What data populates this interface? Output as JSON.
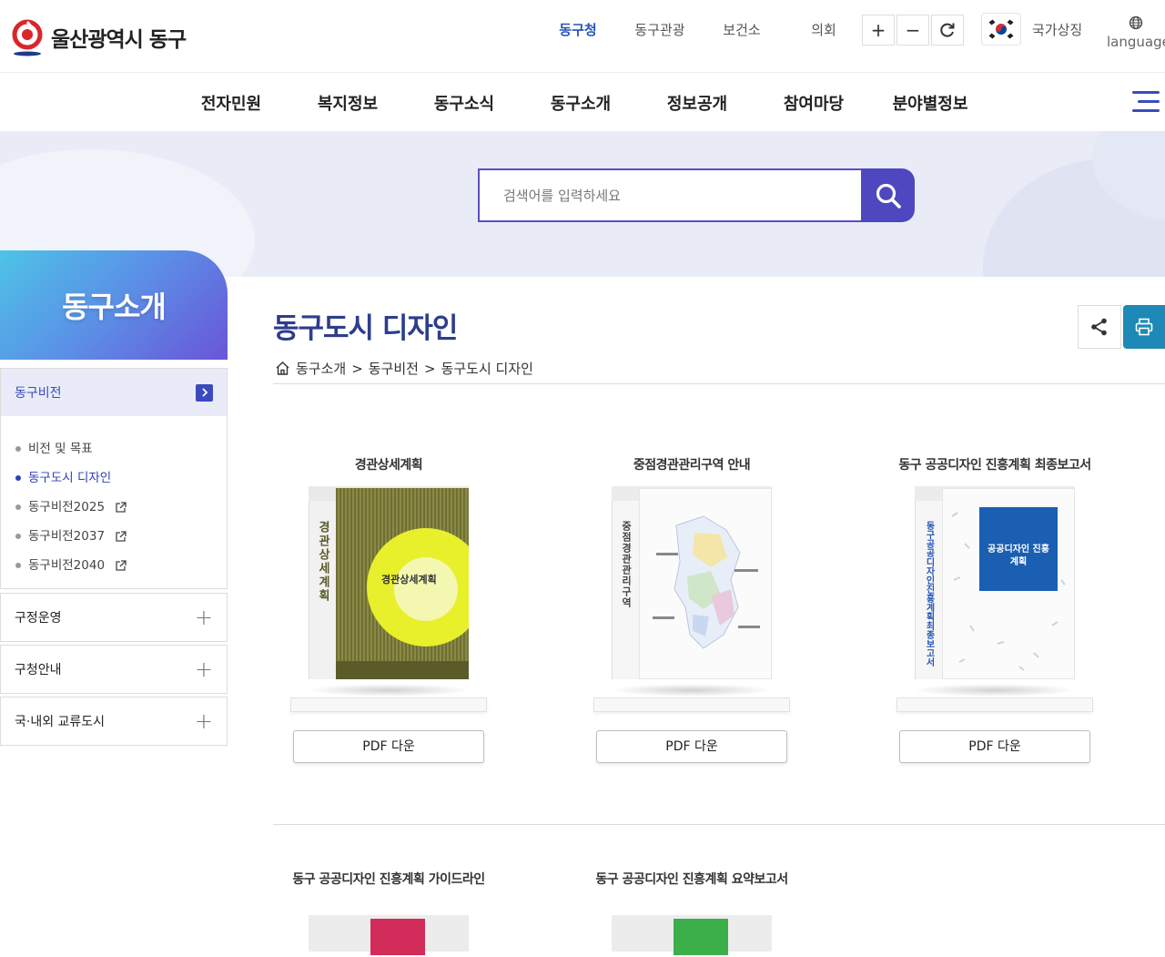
{
  "header": {
    "logo_text": "울산광역시 동구",
    "top_links": [
      "동구청",
      "동구관광",
      "보건소",
      "의회"
    ],
    "zoom_in": "+",
    "zoom_out": "−",
    "symbol_label": "국가상징",
    "language_label": "language"
  },
  "nav": {
    "items": [
      "전자민원",
      "복지정보",
      "동구소식",
      "동구소개",
      "정보공개",
      "참여마당",
      "분야별정보"
    ]
  },
  "search": {
    "placeholder": "검색어를 입력하세요"
  },
  "sidebar": {
    "title": "동구소개",
    "section_active": "동구비전",
    "sub_items": [
      "비전 및 목표",
      "동구도시 디자인",
      "동구비전2025",
      "동구비전2037",
      "동구비전2040"
    ],
    "sections": [
      "구정운영",
      "구청안내",
      "국·내외 교류도시"
    ]
  },
  "content": {
    "page_title": "동구도시 디자인",
    "breadcrumb": [
      "동구소개",
      "동구비전",
      "동구도시 디자인"
    ],
    "breadcrumb_sep": ">",
    "cards": [
      {
        "title": "경관상세계획",
        "button": "PDF 다운",
        "spine": "경관상세계획",
        "cover_title": "경관상세계획"
      },
      {
        "title": "중점경관관리구역 안내",
        "button": "PDF 다운",
        "spine": "중점경관관리구역"
      },
      {
        "title": "동구 공공디자인 진흥계획 최종보고서",
        "button": "PDF 다운",
        "spine": "동구공공디자인진흥계획최종보고서",
        "cover_title": "공공디자인 진흥계획"
      },
      {
        "title": "동구 공공디자인 진흥계획 가이드라인"
      },
      {
        "title": "동구 공공디자인 진흥계획 요약보고서"
      }
    ]
  },
  "colors": {
    "accent": "#3a4bbf",
    "title_blue": "#2c3e8c",
    "print_button": "#1e88b6"
  }
}
